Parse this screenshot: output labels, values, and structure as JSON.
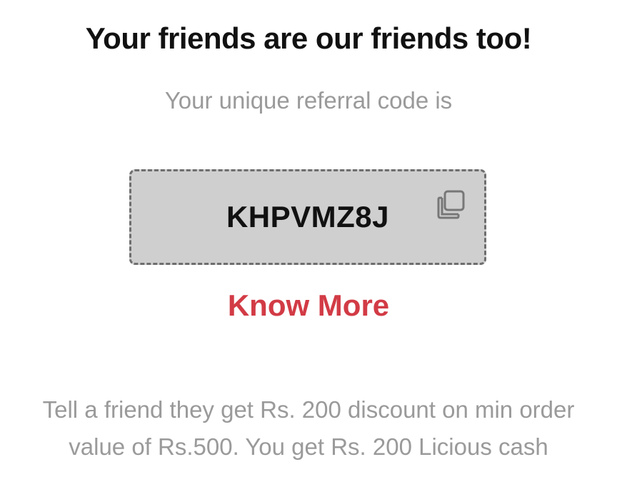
{
  "header": {
    "title": "Your friends are our friends too!",
    "subtitle": "Your unique referral code is"
  },
  "referral": {
    "code": "KHPVMZ8J",
    "copy_icon": "copy-icon",
    "know_more_label": "Know More"
  },
  "description": {
    "text": "Tell a friend they get Rs. 200 discount on min order value of Rs.500. You get Rs. 200 Licious cash"
  },
  "colors": {
    "accent": "#d23b45",
    "muted_text": "#9a9a9a",
    "code_box_bg": "#cfcfcf",
    "code_box_border": "#6e6e6e"
  }
}
